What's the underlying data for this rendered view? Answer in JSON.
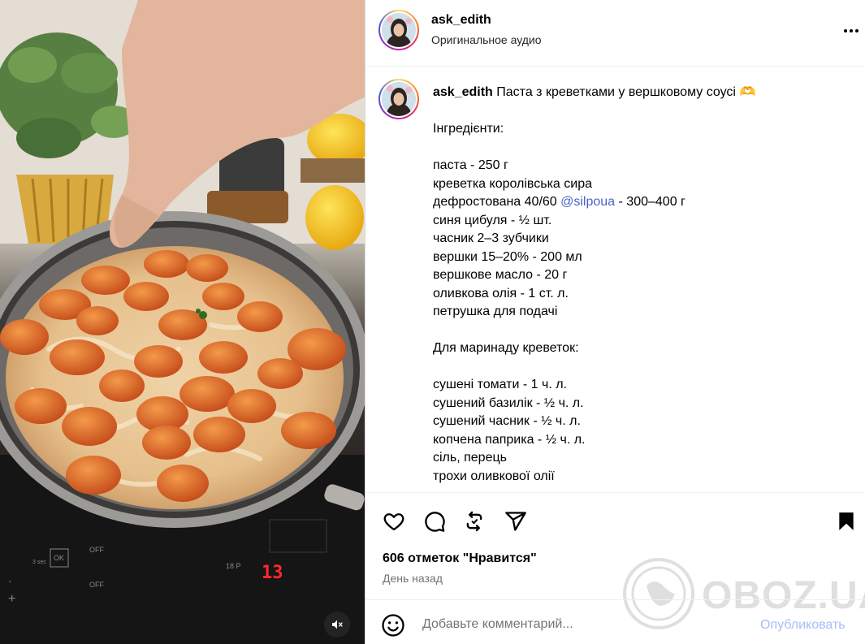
{
  "post": {
    "username": "ask_edith",
    "audio": "Оригинальное аудио"
  },
  "caption": {
    "username": "ask_edith",
    "title": "Паста з креветками у вершковому соусі",
    "title_emoji": "🫶",
    "lines": [
      {
        "text": ""
      },
      {
        "text": "Інгредієнти:"
      },
      {
        "text": ""
      },
      {
        "text": "паста - 250 г"
      },
      {
        "text": "креветка королівська сира"
      },
      {
        "pre": "дефростована 40/60 ",
        "mention": "@silpoua",
        "post": " - 300–400 г"
      },
      {
        "text": "синя цибуля - ½ шт."
      },
      {
        "text": "часник 2–3 зубчики"
      },
      {
        "text": "вершки 15–20% - 200 мл"
      },
      {
        "text": "вершкове масло - 20 г"
      },
      {
        "text": "оливкова олія - 1 ст. л."
      },
      {
        "text": "петрушка для подачі"
      },
      {
        "text": ""
      },
      {
        "text": "Для маринаду креветок:"
      },
      {
        "text": ""
      },
      {
        "text": "сушені томати - 1 ч. л."
      },
      {
        "text": "сушений базилік - ½ ч. л."
      },
      {
        "text": "сушений часник - ½ ч. л."
      },
      {
        "text": "копчена паприка - ½ ч. л."
      },
      {
        "text": "сіль, перець"
      },
      {
        "text": "трохи оливкової олії"
      }
    ]
  },
  "stats": {
    "likes": "606 отметок \"Нравится\"",
    "time": "День назад"
  },
  "comment": {
    "placeholder": "Добавьте комментарий...",
    "publish": "Опубликовать"
  },
  "watermark": {
    "text": "OBOZ.UA"
  },
  "video": {
    "cooktop_labels": [
      "OK",
      "OFF",
      "OFF",
      "18 P"
    ],
    "display": "13",
    "sec_label": "3 sec"
  },
  "icons": {
    "like": "heart-icon",
    "comment": "comment-icon",
    "repost": "repost-icon",
    "share": "share-icon",
    "save": "bookmark-icon",
    "more": "more-icon",
    "mute": "muted-speaker-icon",
    "emoji": "emoji-icon"
  },
  "colors": {
    "accent_link": "#4a63c8",
    "publish_disabled": "#a6bef5",
    "muted_text": "#737373"
  }
}
